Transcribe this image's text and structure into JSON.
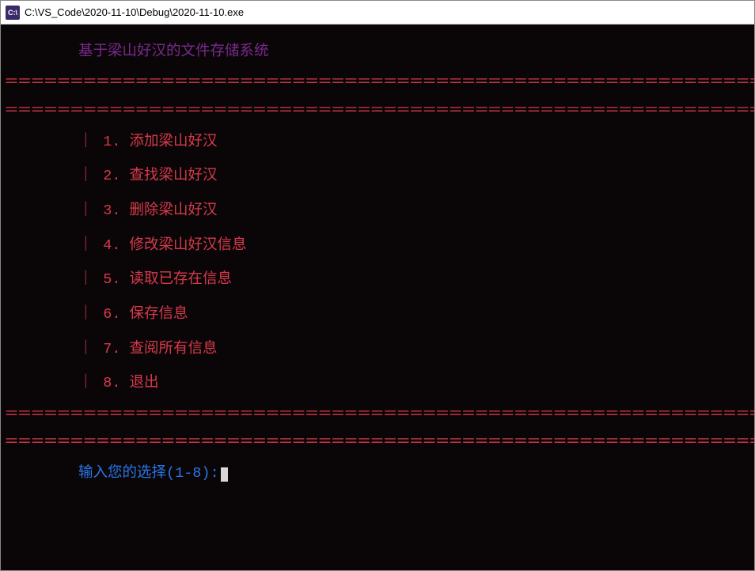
{
  "window": {
    "icon_text": "C:\\",
    "title": "C:\\VS_Code\\2020-11-10\\Debug\\2020-11-10.exe"
  },
  "console": {
    "title": "基于梁山好汉的文件存储系统",
    "separator": "＝＝＝＝＝＝＝＝＝＝＝＝＝＝＝＝＝＝＝＝＝＝＝＝＝＝＝＝＝＝＝＝＝＝＝＝＝＝＝＝＝＝＝＝＝＝＝＝＝＝＝＝＝＝＝＝＝＝＝＝＝＝＝＝＝＝＝＝＝＝＝＝＝＝＝＝＝＝",
    "menu": {
      "bar": "｜",
      "items": [
        {
          "num": "1",
          "label": "添加梁山好汉"
        },
        {
          "num": "2",
          "label": "查找梁山好汉"
        },
        {
          "num": "3",
          "label": "删除梁山好汉"
        },
        {
          "num": "4",
          "label": "修改梁山好汉信息"
        },
        {
          "num": "5",
          "label": "读取已存在信息"
        },
        {
          "num": "6",
          "label": "保存信息"
        },
        {
          "num": "7",
          "label": "查阅所有信息"
        },
        {
          "num": "8",
          "label": "退出"
        }
      ]
    },
    "prompt": "输入您的选择(1-8):"
  },
  "colors": {
    "background": "#0a0608",
    "title_color": "#7a2a8c",
    "menu_color": "#d63a4a",
    "prompt_color": "#2a75e8"
  }
}
